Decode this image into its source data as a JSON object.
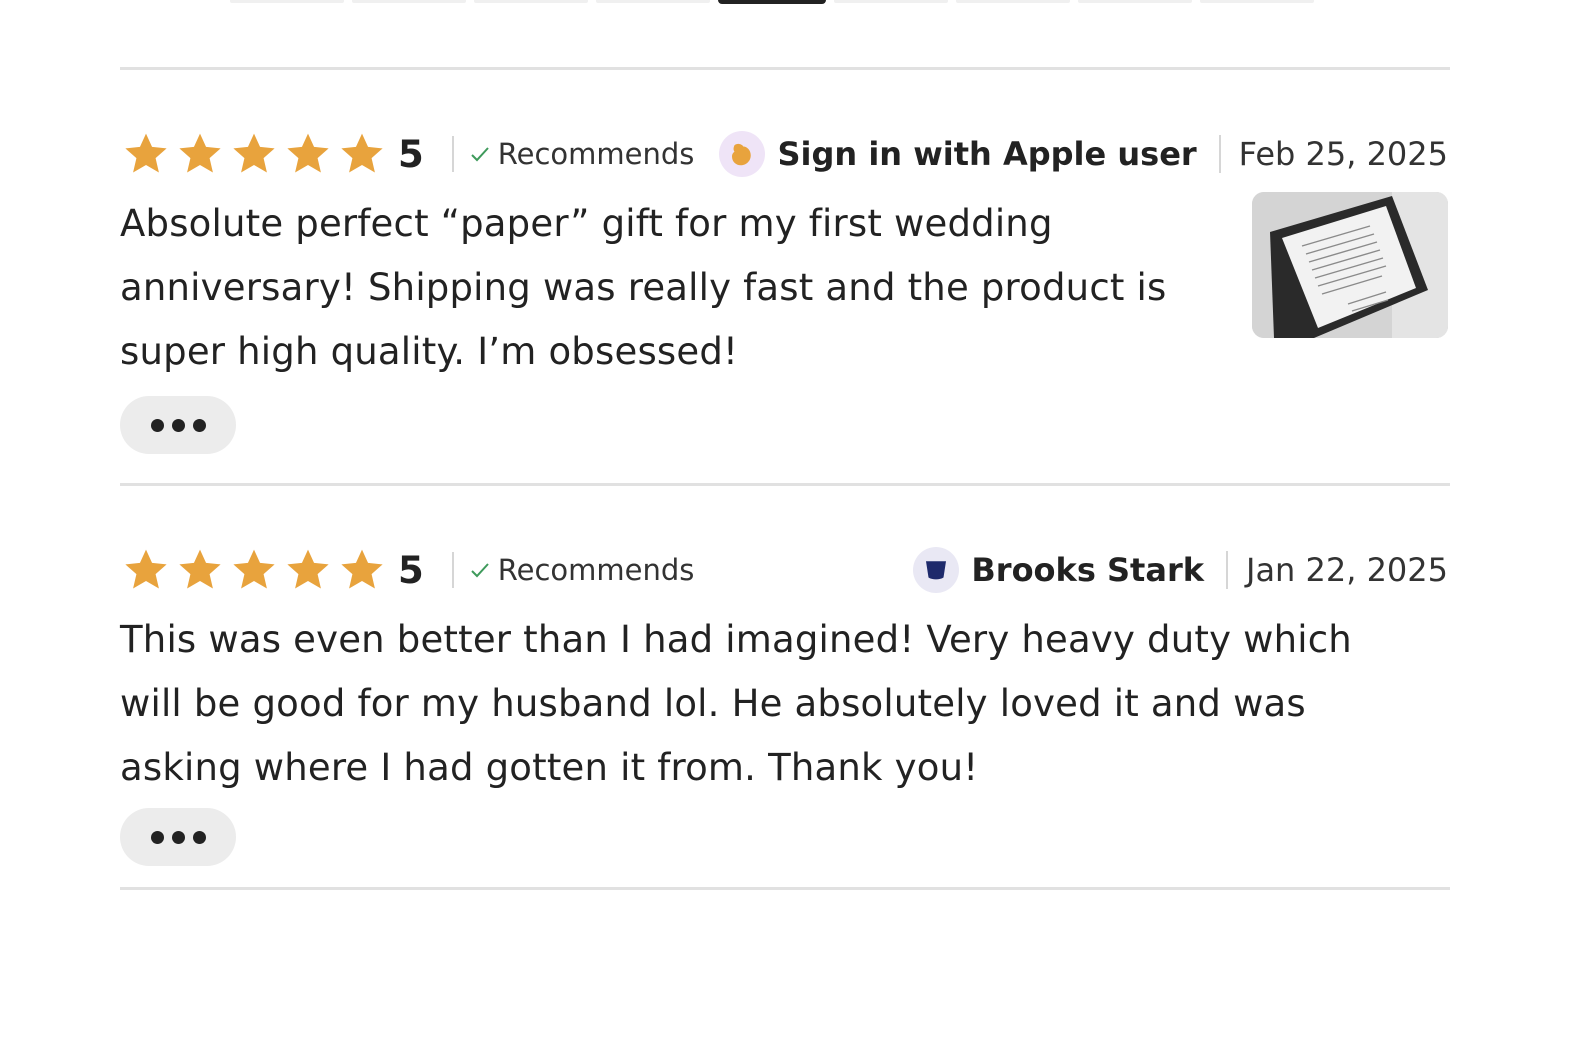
{
  "colors": {
    "star": "#E8A33D",
    "check": "#3E9A5B",
    "divider": "#E1E1E1"
  },
  "reviews": [
    {
      "rating": 5,
      "score_label": "5",
      "stars_icon": "star-icon",
      "recommends_label": "Recommends",
      "user": "Sign in with Apple user",
      "avatar_icon": "apple-user-avatar-icon",
      "date": "Feb 25, 2025",
      "text": "Absolute perfect “paper” gift for my first wedding anniversary! Shipping was really fast and the product is super high quality. I’m obsessed!",
      "has_photo": true,
      "more_icon": "more-dots-icon"
    },
    {
      "rating": 5,
      "score_label": "5",
      "stars_icon": "star-icon",
      "recommends_label": "Recommends",
      "user": "Brooks Stark",
      "avatar_icon": "user-avatar-icon",
      "date": "Jan 22, 2025",
      "text": "This was even better than I had imagined! Very heavy duty which will be good for my husband lol. He absolutely loved it and was asking where I had gotten it from. Thank you!",
      "has_photo": false,
      "more_icon": "more-dots-icon"
    }
  ]
}
